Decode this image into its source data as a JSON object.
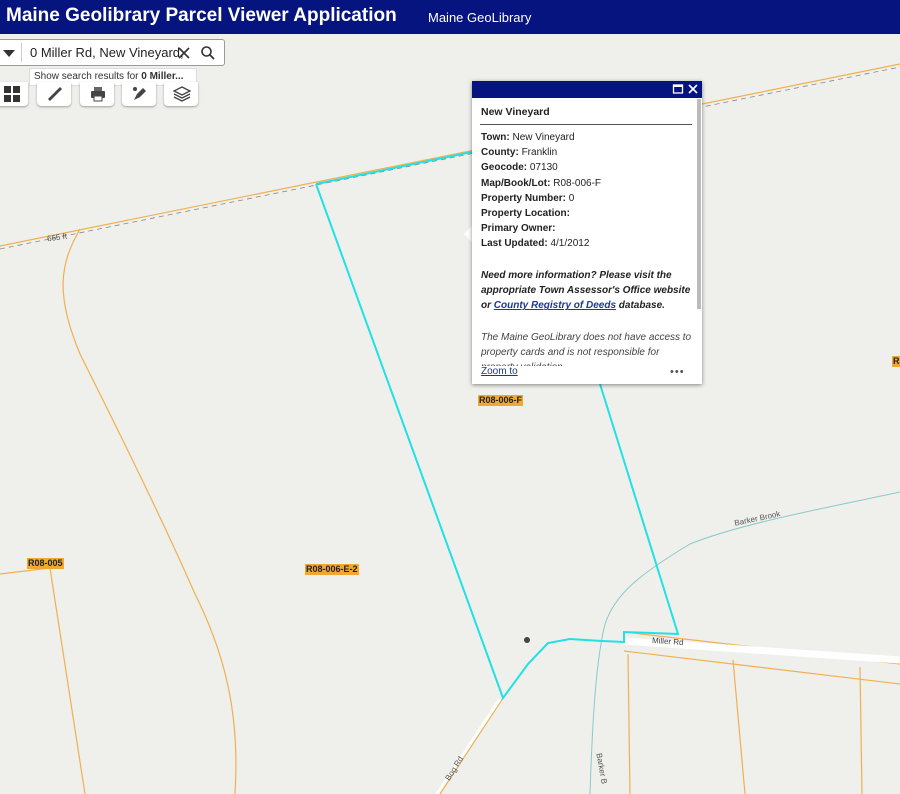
{
  "header": {
    "title": "Maine Geolibrary Parcel Viewer Application",
    "subtitle": "Maine GeoLibrary"
  },
  "search": {
    "value": "0 Miller Rd, New Vineyard,",
    "hint_prefix": "Show search results for ",
    "hint_bold": "0 Miller..."
  },
  "toolbar": {
    "tools": [
      "basemap-gallery-icon",
      "measure-icon",
      "print-icon",
      "draw-icon",
      "layers-icon"
    ]
  },
  "popup": {
    "title": "New Vineyard",
    "fields": [
      {
        "label": "Town:",
        "value": "New Vineyard"
      },
      {
        "label": "County:",
        "value": "Franklin"
      },
      {
        "label": "Geocode:",
        "value": "07130"
      },
      {
        "label": "Map/Book/Lot:",
        "value": "R08-006-F"
      },
      {
        "label": "Property Number:",
        "value": "0"
      },
      {
        "label": "Property Location:",
        "value": ""
      },
      {
        "label": "Primary Owner:",
        "value": ""
      },
      {
        "label": "Last Updated:",
        "value": "4/1/2012"
      }
    ],
    "note_before_link": "Need more information? Please visit the appropriate Town Assessor's Office website or ",
    "note_link": "County Registry of Deeds",
    "note_after_link": " database.",
    "note2": "The Maine GeoLibrary does not have access to property cards and is not responsible for property validation.",
    "zoom_to": "Zoom to",
    "more": "•••"
  },
  "map": {
    "parcel_labels": [
      "R08-006-F",
      "R08-005",
      "R08-006-E-2",
      "R"
    ],
    "road_labels": {
      "elevation": "665 ft",
      "brook": "Barker Brook",
      "miller": "Miller Rd",
      "bog": "Bog Rd",
      "barker_lower": "Barker B"
    },
    "colors": {
      "header": "#06147f",
      "parcel_highlight": "#21e1e4",
      "parcel_line": "#f0b050",
      "label_bg": "#f0a830",
      "water": "#8ac9c9"
    }
  }
}
